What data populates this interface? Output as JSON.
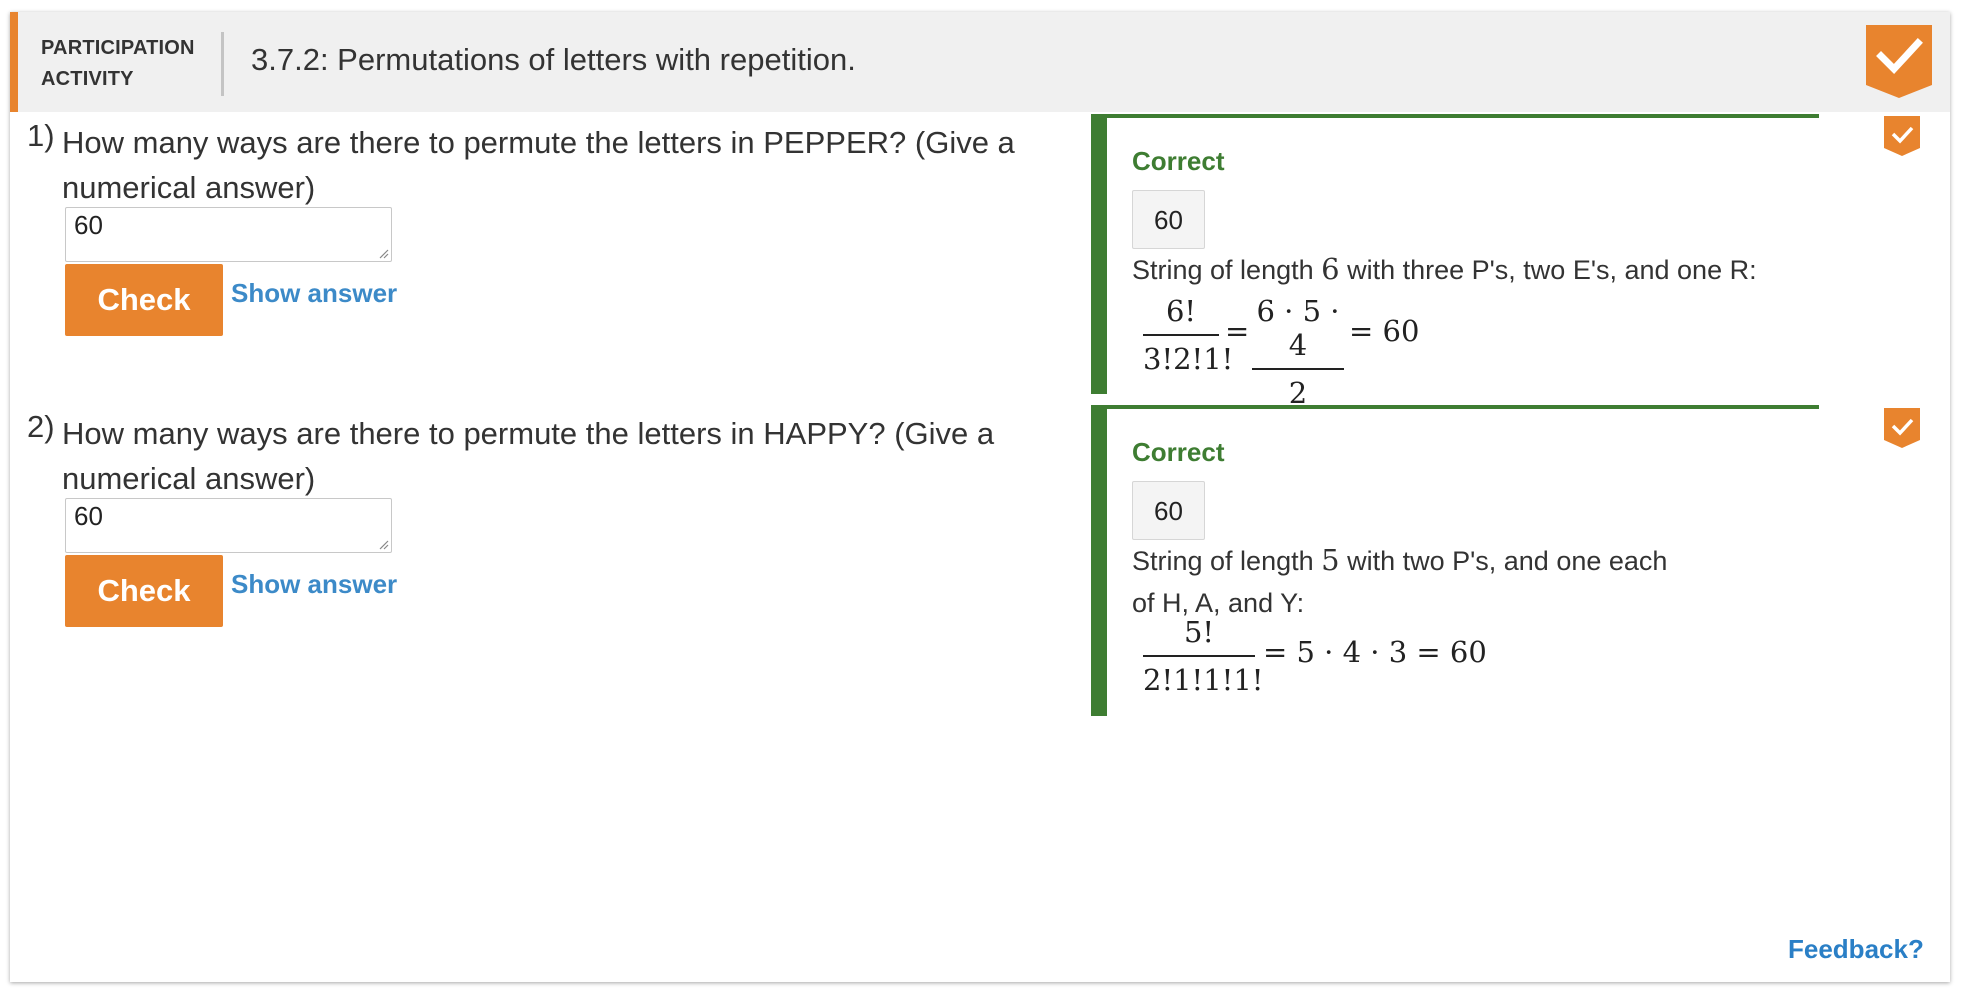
{
  "header": {
    "activity_type_line1": "PARTICIPATION",
    "activity_type_line2": "ACTIVITY",
    "title": "3.7.2: Permutations of letters with repetition.",
    "completion_badge_icon": "checkmark-badge-icon"
  },
  "colors": {
    "accent_orange": "#e8842e",
    "correct_green": "#3e7d32",
    "link_blue": "#3c8ac8",
    "header_bg": "#f0f0f0"
  },
  "questions": [
    {
      "number": "1)",
      "text": "How many ways are there to permute the letters in PEPPER? (Give a numerical answer)",
      "answer_value": "60",
      "check_label": "Check",
      "show_answer_label": "Show answer",
      "status_icon": "checkmark-icon",
      "feedback": {
        "status": "Correct",
        "answer_echo": "60",
        "explanation_pre": "String of length ",
        "explanation_var": "6",
        "explanation_post": " with three P's, two E's, and one R:",
        "frac1_num": "6!",
        "frac1_den": "3!2!1!",
        "eq1": "=",
        "frac2_num": "6 · 5 · 4",
        "frac2_den": "2",
        "tail": "= 60"
      }
    },
    {
      "number": "2)",
      "text": "How many ways are there to permute the letters in HAPPY? (Give a numerical answer)",
      "answer_value": "60",
      "check_label": "Check",
      "show_answer_label": "Show answer",
      "status_icon": "checkmark-icon",
      "feedback": {
        "status": "Correct",
        "answer_echo": "60",
        "explanation_pre": "String of length ",
        "explanation_var": "5",
        "explanation_post": " with two P's, and one each of H, A, and Y:",
        "frac1_num": "5!",
        "frac1_den": "2!1!1!1!",
        "tail": "= 5 · 4 · 3 = 60"
      }
    }
  ],
  "footer": {
    "feedback_link": "Feedback?"
  }
}
